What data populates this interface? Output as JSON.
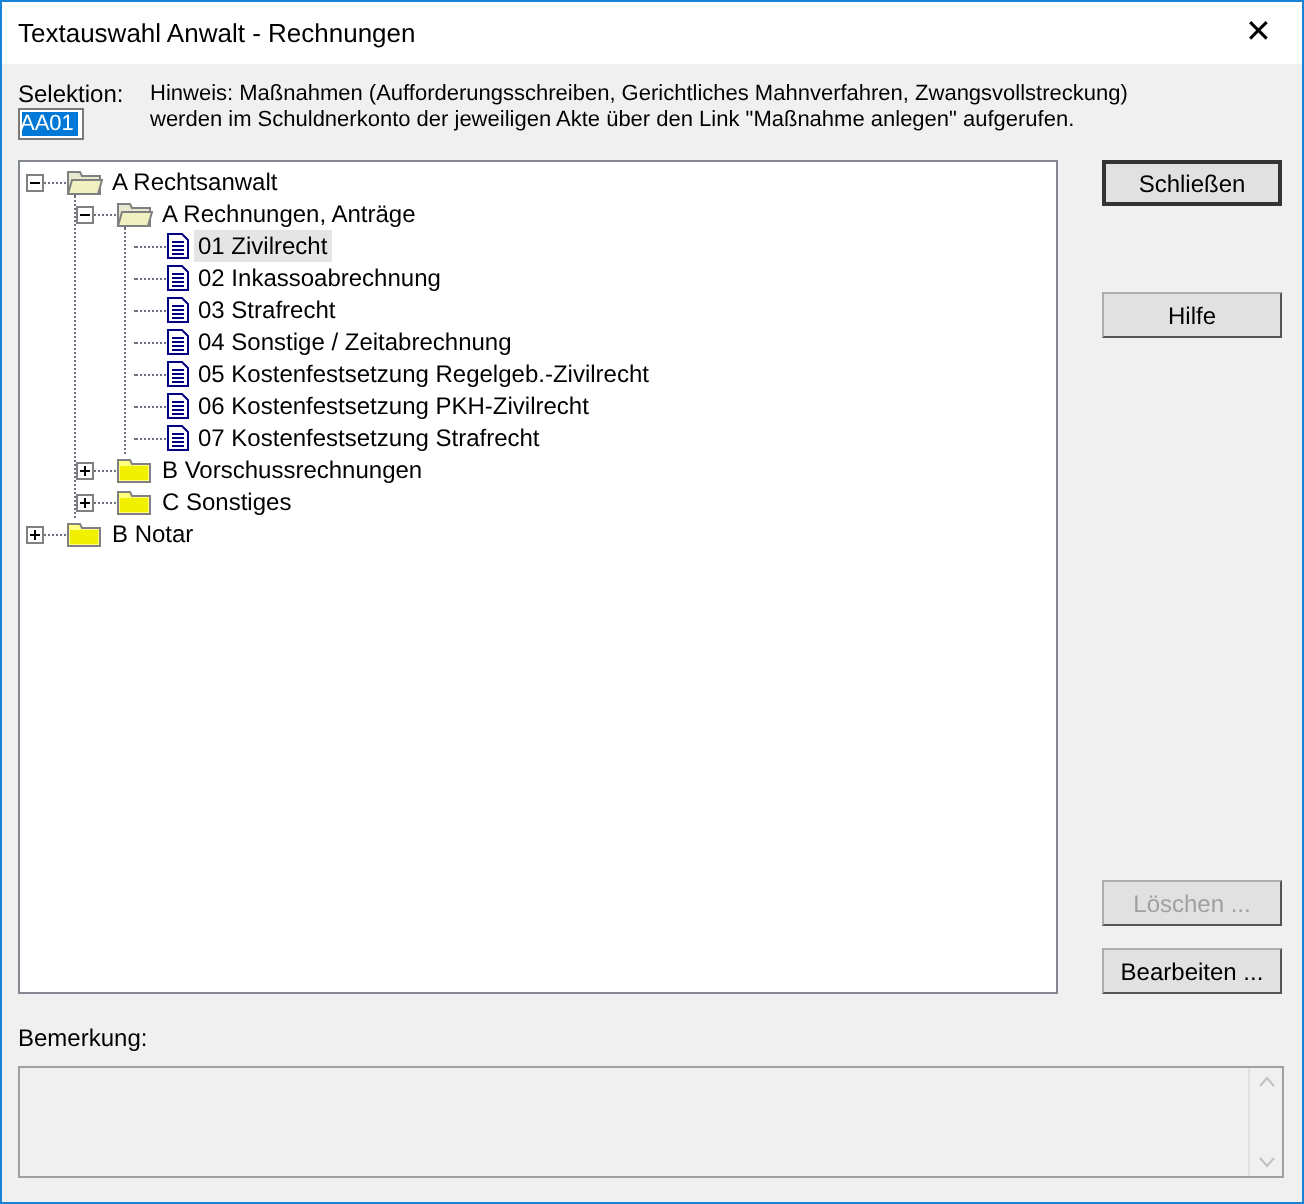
{
  "window": {
    "title": "Textauswahl Anwalt - Rechnungen",
    "close": "✕"
  },
  "selection": {
    "label": "Selektion:",
    "value": "AA01"
  },
  "hint": [
    "Hinweis: Maßnahmen (Aufforderungsschreiben, Gerichtliches Mahnverfahren, Zwangsvollstreckung)",
    "werden im Schuldnerkonto der jeweiligen Akte über den Link \"Maßnahme anlegen\" aufgerufen."
  ],
  "tree": [
    {
      "label": "A Rechtsanwalt",
      "kind": "folder",
      "expanded": true,
      "selected": false,
      "children": [
        {
          "label": "A Rechnungen, Anträge",
          "kind": "folder",
          "expanded": true,
          "selected": false,
          "children": [
            {
              "label": "01 Zivilrecht",
              "kind": "document",
              "selected": true
            },
            {
              "label": "02 Inkassoabrechnung",
              "kind": "document",
              "selected": false
            },
            {
              "label": "03 Strafrecht",
              "kind": "document",
              "selected": false
            },
            {
              "label": "04 Sonstige / Zeitabrechnung",
              "kind": "document",
              "selected": false
            },
            {
              "label": "05 Kostenfestsetzung Regelgeb.-Zivilrecht",
              "kind": "document",
              "selected": false
            },
            {
              "label": "06 Kostenfestsetzung PKH-Zivilrecht",
              "kind": "document",
              "selected": false
            },
            {
              "label": "07 Kostenfestsetzung Strafrecht",
              "kind": "document",
              "selected": false
            }
          ]
        },
        {
          "label": "B Vorschussrechnungen",
          "kind": "folder",
          "expanded": false,
          "selected": false
        },
        {
          "label": "C Sonstiges",
          "kind": "folder",
          "expanded": false,
          "selected": false
        }
      ]
    },
    {
      "label": "B Notar",
      "kind": "folder",
      "expanded": false,
      "selected": false
    }
  ],
  "buttons": [
    {
      "label": "Schließen",
      "disabled": false,
      "default": true
    },
    {
      "label": "Hilfe",
      "disabled": false,
      "default": false
    },
    {
      "label": "Löschen ...",
      "disabled": true,
      "default": false
    },
    {
      "label": "Bearbeiten ...",
      "disabled": false,
      "default": false
    }
  ],
  "remark": {
    "label": "Bemerkung:"
  }
}
